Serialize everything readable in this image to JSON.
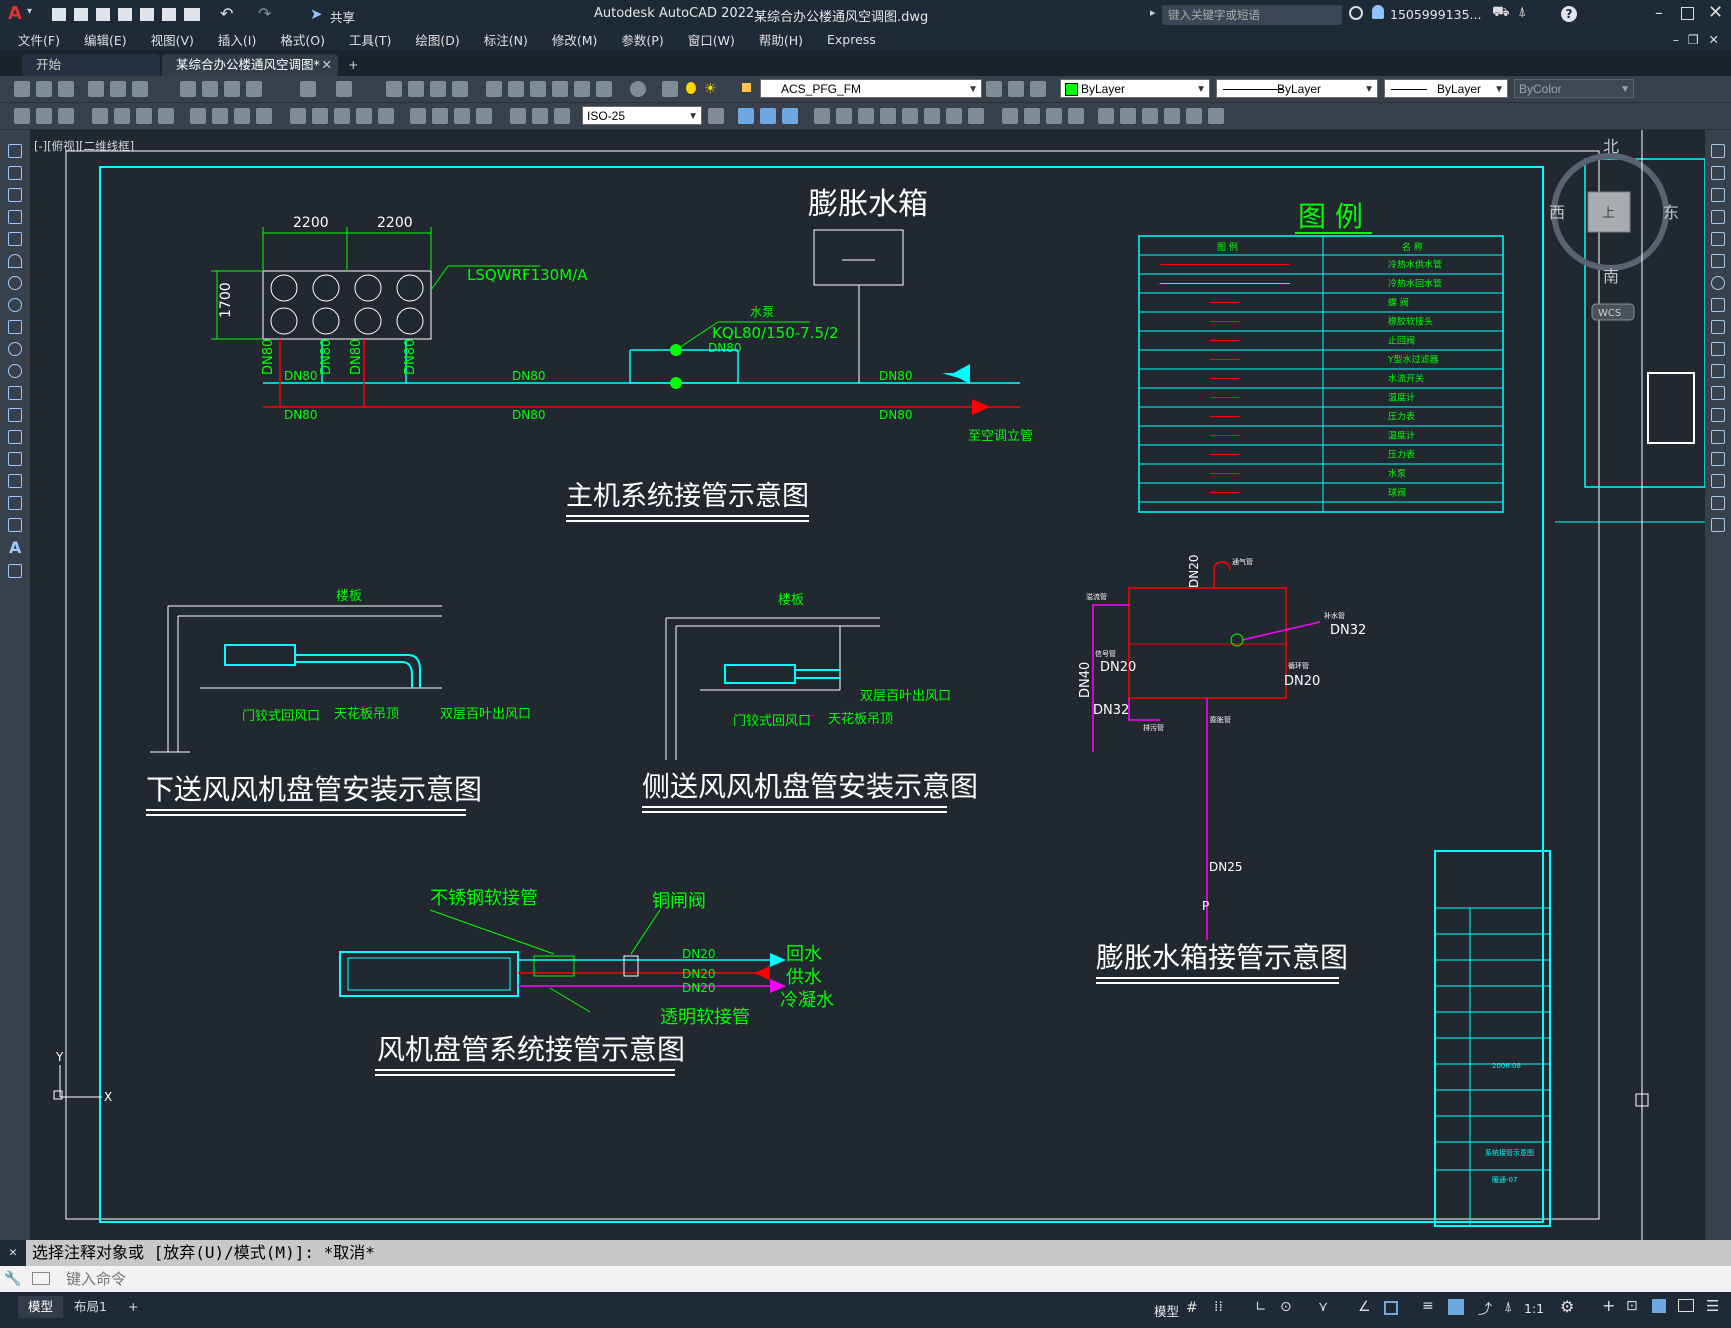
{
  "app": {
    "title": "Autodesk AutoCAD 2022",
    "filename": "某综合办公楼通风空调图.dwg",
    "share_label": "共享",
    "search_placeholder": "键入关键字或短语",
    "user": "1505999135...",
    "logo": "A"
  },
  "menu": [
    "文件(F)",
    "编辑(E)",
    "视图(V)",
    "插入(I)",
    "格式(O)",
    "工具(T)",
    "绘图(D)",
    "标注(N)",
    "修改(M)",
    "参数(P)",
    "窗口(W)",
    "帮助(H)",
    "Express"
  ],
  "tabs": [
    {
      "label": "开始",
      "active": false
    },
    {
      "label": "某综合办公楼通风空调图*",
      "active": true
    }
  ],
  "toolbar": {
    "layer": "ACS_PFG_FM",
    "color": "ByLayer",
    "linetype": "ByLayer",
    "lineweight": "ByLayer",
    "plotstyle": "ByColor",
    "dimstyle": "ISO-25"
  },
  "viewport_label": "[-][俯视][二维线框]",
  "viewcube": {
    "north": "北",
    "south": "南",
    "west": "西",
    "east": "东",
    "top": "上",
    "wcs": "WCS"
  },
  "command": {
    "history": "选择注释对象或 [放弃(U)/模式(M)]: *取消*",
    "placeholder": "键入命令"
  },
  "layout_tabs": [
    "模型",
    "布局1"
  ],
  "status": {
    "model": "模型",
    "scale": "1:1"
  },
  "colors": {
    "cyan": "#00ffff",
    "green": "#00ff00",
    "red": "#ff0000",
    "magenta": "#ff00ff",
    "bg": "#212830"
  },
  "drawing": {
    "main_system": {
      "title": "主机系统接管示意图",
      "dim1": "2200",
      "dim2": "2200",
      "dim_h": "1700",
      "unit_model": "LSQWRF130M/A",
      "pump_label": "水泵",
      "pump_model": "KQL80/150-7.5/2",
      "dn80": "DN80",
      "to_riser": "至空调立管",
      "tank_title": "膨胀水箱"
    },
    "legend": {
      "title": "图 例",
      "col1": "图 例",
      "col2": "名 称",
      "rows": [
        "冷热水供水管",
        "冷热水回水管",
        "蝶 阀",
        "橡胶软接头",
        "止回阀",
        "Y型水过滤器",
        "水流开关",
        "温度计",
        "压力表",
        "温度计",
        "压力表",
        "水泵",
        "球阀"
      ]
    },
    "down_fcu": {
      "title": "下送风风机盘管安装示意图",
      "slab": "楼板",
      "return_air": "门铰式回风口",
      "ceiling": "天花板吊顶",
      "supply": "双层百叶出风口"
    },
    "side_fcu": {
      "title": "侧送风风机盘管安装示意图",
      "slab": "楼板",
      "return_air": "门铰式回风口",
      "ceiling": "天花板吊顶",
      "supply": "双层百叶出风口"
    },
    "tank_pipe": {
      "title": "膨胀水箱接管示意图",
      "dn20": "DN20",
      "dn20b": "DN20",
      "dn20c": "DN20",
      "dn32": "DN32",
      "dn32b": "DN32",
      "dn40": "DN40",
      "dn25": "DN25",
      "vent": "通气管",
      "overflow": "溢流管",
      "inlet": "补水管",
      "signal": "信号管",
      "circ": "循环管",
      "drain": "排污管",
      "expan": "膨胀管",
      "p": "P"
    },
    "fcu_system": {
      "title": "风机盘管系统接管示意图",
      "flex": "不锈钢软接管",
      "valve": "铜闸阀",
      "clear": "透明软接管",
      "dn20a": "DN20",
      "dn20b": "DN20",
      "dn20c": "DN20",
      "return": "回水",
      "supply": "供水",
      "condensate": "冷凝水"
    },
    "titleblock": {
      "date": "2008.08",
      "sheet_name": "系统接管示意图",
      "sheet_no": "暖通-07"
    }
  }
}
